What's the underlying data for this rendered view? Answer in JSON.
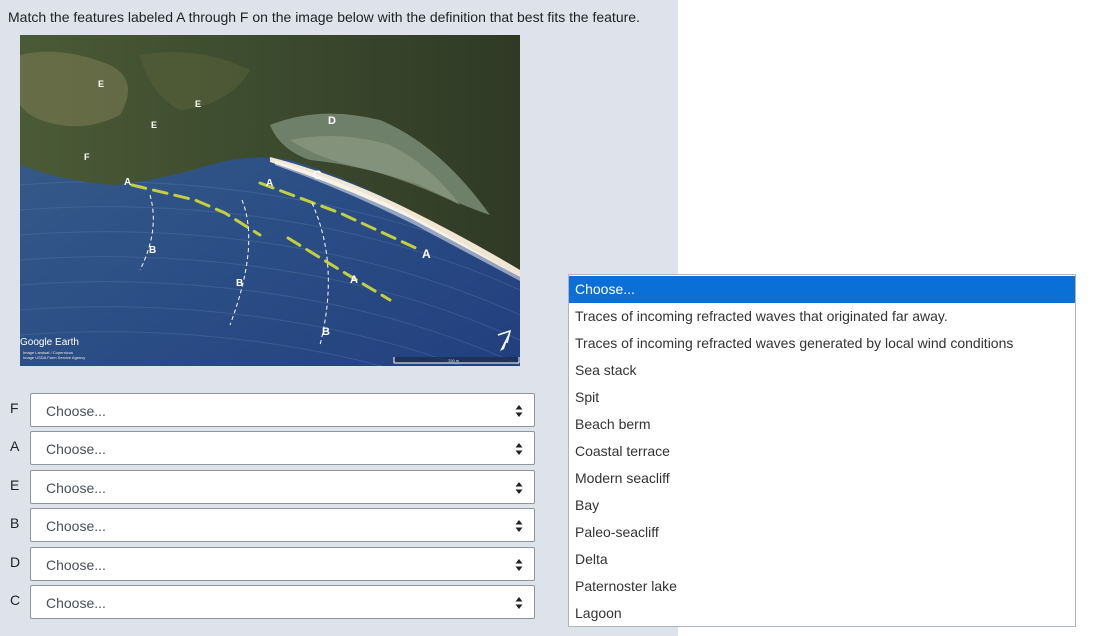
{
  "question": {
    "prompt": "Match the features labeled A through F on the image below with the definition that best fits the feature."
  },
  "image": {
    "watermark": "Google Earth",
    "credits_line1": "Image Landsat / Copernicus",
    "credits_line2": "Image USDA Farm Service Agency",
    "scale_label": "700 m",
    "labels": [
      "E",
      "E",
      "E",
      "D",
      "F",
      "C",
      "A",
      "A",
      "A",
      "A",
      "B",
      "B",
      "B"
    ]
  },
  "rows": [
    {
      "letter": "F",
      "value": "Choose..."
    },
    {
      "letter": "A",
      "value": "Choose..."
    },
    {
      "letter": "E",
      "value": "Choose..."
    },
    {
      "letter": "B",
      "value": "Choose..."
    },
    {
      "letter": "D",
      "value": "Choose..."
    },
    {
      "letter": "C",
      "value": "Choose..."
    }
  ],
  "dropdown": {
    "selected_index": 0,
    "options": [
      "Choose...",
      "Traces of incoming refracted waves that originated far away.",
      "Traces of incoming refracted waves generated by local wind conditions",
      "Sea stack",
      "Spit",
      "Beach berm",
      "Coastal terrace",
      "Modern seacliff",
      "Bay",
      "Paleo-seacliff",
      "Delta",
      "Paternoster lake",
      "Lagoon"
    ]
  },
  "colors": {
    "panel_bg": "#dee2ea",
    "selected_option_bg": "#0a6fd6",
    "wave_dash": "#c4cf3e"
  }
}
